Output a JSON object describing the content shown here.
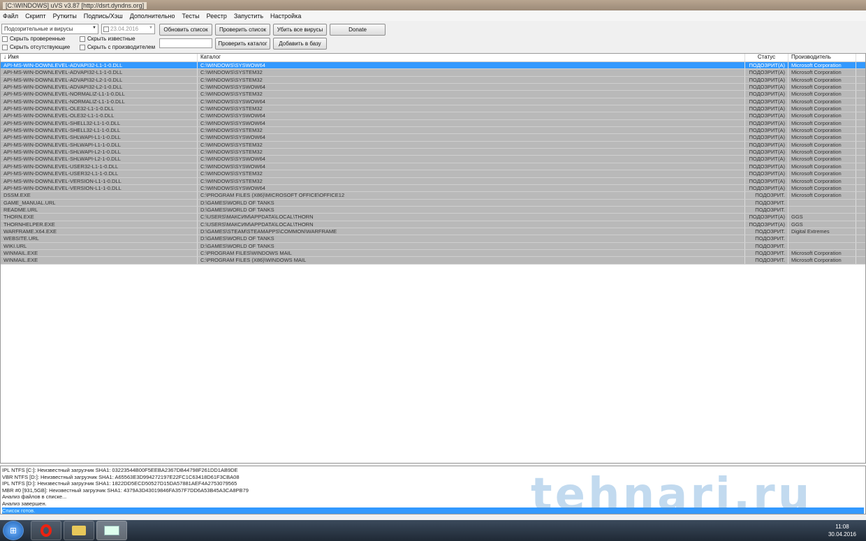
{
  "window": {
    "title": "[C:\\WINDOWS] uVS v3.87 [http://dsrt.dyndns.org]"
  },
  "menu": [
    "Файл",
    "Скрипт",
    "Руткиты",
    "Подпись/Хэш",
    "Дополнительно",
    "Тесты",
    "Реестр",
    "Запустить",
    "Настройка"
  ],
  "toolbar": {
    "filter_value": "Подозрительные и вирусы",
    "date_value": "23.04.2016",
    "refresh": "Обновить список",
    "check_list": "Проверить список",
    "kill_all": "Убить все вирусы",
    "donate": "Donate",
    "check_dir": "Проверить каталог",
    "add_db": "Добавить в базу",
    "cb_hide_checked": "Скрыть проверенные",
    "cb_hide_known": "Скрыть известные",
    "cb_hide_missing": "Скрыть отсутствующие",
    "cb_hide_vendor": "Скрыть с производителем"
  },
  "columns": [
    "↓ Имя",
    "Каталог",
    "Статус",
    "Производитель"
  ],
  "rows": [
    [
      "API-MS-WIN-DOWNLEVEL-ADVAPI32-L1-1-0.DLL",
      "C:\\WINDOWS\\SYSWOW64",
      "ПОДОЗРИТ(А)",
      "Microsoft Corporation"
    ],
    [
      "API-MS-WIN-DOWNLEVEL-ADVAPI32-L1-1-0.DLL",
      "C:\\WINDOWS\\SYSTEM32",
      "ПОДОЗРИТ(А)",
      "Microsoft Corporation"
    ],
    [
      "API-MS-WIN-DOWNLEVEL-ADVAPI32-L2-1-0.DLL",
      "C:\\WINDOWS\\SYSTEM32",
      "ПОДОЗРИТ(А)",
      "Microsoft Corporation"
    ],
    [
      "API-MS-WIN-DOWNLEVEL-ADVAPI32-L2-1-0.DLL",
      "C:\\WINDOWS\\SYSWOW64",
      "ПОДОЗРИТ(А)",
      "Microsoft Corporation"
    ],
    [
      "API-MS-WIN-DOWNLEVEL-NORMALIZ-L1-1-0.DLL",
      "C:\\WINDOWS\\SYSTEM32",
      "ПОДОЗРИТ(А)",
      "Microsoft Corporation"
    ],
    [
      "API-MS-WIN-DOWNLEVEL-NORMALIZ-L1-1-0.DLL",
      "C:\\WINDOWS\\SYSWOW64",
      "ПОДОЗРИТ(А)",
      "Microsoft Corporation"
    ],
    [
      "API-MS-WIN-DOWNLEVEL-OLE32-L1-1-0.DLL",
      "C:\\WINDOWS\\SYSTEM32",
      "ПОДОЗРИТ(А)",
      "Microsoft Corporation"
    ],
    [
      "API-MS-WIN-DOWNLEVEL-OLE32-L1-1-0.DLL",
      "C:\\WINDOWS\\SYSWOW64",
      "ПОДОЗРИТ(А)",
      "Microsoft Corporation"
    ],
    [
      "API-MS-WIN-DOWNLEVEL-SHELL32-L1-1-0.DLL",
      "C:\\WINDOWS\\SYSWOW64",
      "ПОДОЗРИТ(А)",
      "Microsoft Corporation"
    ],
    [
      "API-MS-WIN-DOWNLEVEL-SHELL32-L1-1-0.DLL",
      "C:\\WINDOWS\\SYSTEM32",
      "ПОДОЗРИТ(А)",
      "Microsoft Corporation"
    ],
    [
      "API-MS-WIN-DOWNLEVEL-SHLWAPI-L1-1-0.DLL",
      "C:\\WINDOWS\\SYSWOW64",
      "ПОДОЗРИТ(А)",
      "Microsoft Corporation"
    ],
    [
      "API-MS-WIN-DOWNLEVEL-SHLWAPI-L1-1-0.DLL",
      "C:\\WINDOWS\\SYSTEM32",
      "ПОДОЗРИТ(А)",
      "Microsoft Corporation"
    ],
    [
      "API-MS-WIN-DOWNLEVEL-SHLWAPI-L2-1-0.DLL",
      "C:\\WINDOWS\\SYSTEM32",
      "ПОДОЗРИТ(А)",
      "Microsoft Corporation"
    ],
    [
      "API-MS-WIN-DOWNLEVEL-SHLWAPI-L2-1-0.DLL",
      "C:\\WINDOWS\\SYSWOW64",
      "ПОДОЗРИТ(А)",
      "Microsoft Corporation"
    ],
    [
      "API-MS-WIN-DOWNLEVEL-USER32-L1-1-0.DLL",
      "C:\\WINDOWS\\SYSWOW64",
      "ПОДОЗРИТ(А)",
      "Microsoft Corporation"
    ],
    [
      "API-MS-WIN-DOWNLEVEL-USER32-L1-1-0.DLL",
      "C:\\WINDOWS\\SYSTEM32",
      "ПОДОЗРИТ(А)",
      "Microsoft Corporation"
    ],
    [
      "API-MS-WIN-DOWNLEVEL-VERSION-L1-1-0.DLL",
      "C:\\WINDOWS\\SYSTEM32",
      "ПОДОЗРИТ(А)",
      "Microsoft Corporation"
    ],
    [
      "API-MS-WIN-DOWNLEVEL-VERSION-L1-1-0.DLL",
      "C:\\WINDOWS\\SYSWOW64",
      "ПОДОЗРИТ(А)",
      "Microsoft Corporation"
    ],
    [
      "DSSM.EXE",
      "C:\\PROGRAM FILES (X86)\\MICROSOFT OFFICE\\OFFICE12",
      "ПОДОЗРИТ.",
      "Microsoft Corporation"
    ],
    [
      "GAME_MANUAL.URL",
      "D:\\GAMES\\WORLD OF TANKS",
      "ПОДОЗРИТ.",
      ""
    ],
    [
      "README.URL",
      "D:\\GAMES\\WORLD OF TANKS",
      "ПОДОЗРИТ.",
      ""
    ],
    [
      "THORN.EXE",
      "C:\\USERS\\МАКСИМ\\APPDATA\\LOCAL\\THORN",
      "ПОДОЗРИТ(А)",
      "GGS"
    ],
    [
      "THORNHELPER.EXE",
      "C:\\USERS\\МАКСИМ\\APPDATA\\LOCAL\\THORN",
      "ПОДОЗРИТ(А)",
      "GGS"
    ],
    [
      "WARFRAME.X64.EXE",
      "D:\\GAMES\\STEAM\\STEAMAPPS\\COMMON\\WARFRAME",
      "ПОДОЗРИТ.",
      "Digital Extremes"
    ],
    [
      "WEBSITE.URL",
      "D:\\GAMES\\WORLD OF TANKS",
      "ПОДОЗРИТ.",
      ""
    ],
    [
      "WIKI.URL",
      "D:\\GAMES\\WORLD OF TANKS",
      "ПОДОЗРИТ.",
      ""
    ],
    [
      "WINMAIL.EXE",
      "C:\\PROGRAM FILES\\WINDOWS MAIL",
      "ПОДОЗРИТ.",
      "Microsoft Corporation"
    ],
    [
      "WINMAIL.EXE",
      "C:\\PROGRAM FILES (X86)\\WINDOWS MAIL",
      "ПОДОЗРИТ.",
      "Microsoft Corporation"
    ]
  ],
  "log": [
    "IPL NTFS [C:]: Неизвестный загрузчик SHA1: 03223544B00F5EEBA2367DB44798F261DD1AB9DE",
    "VBR NTFS [D:]: Неизвестный загрузчик SHA1: A65563E3D994272197E22FC1C63418D61F3CBA08",
    "IPL NTFS [D:]: Неизвестный загрузчик SHA1: 1822DD5ECD50527D15DA57881AEF4A2753079565",
    "MBR #0 [931,5GB]: Неизвестный загрузчик SHA1: 4379A3D43019846FA357F7DD6A53B45A3CA8PB79",
    "Анализ файлов в списке...",
    "Анализ завершен.",
    "Список готов."
  ],
  "watermark": "tehnari.ru",
  "clock": {
    "time": "11:08",
    "date": "30.04.2016"
  }
}
